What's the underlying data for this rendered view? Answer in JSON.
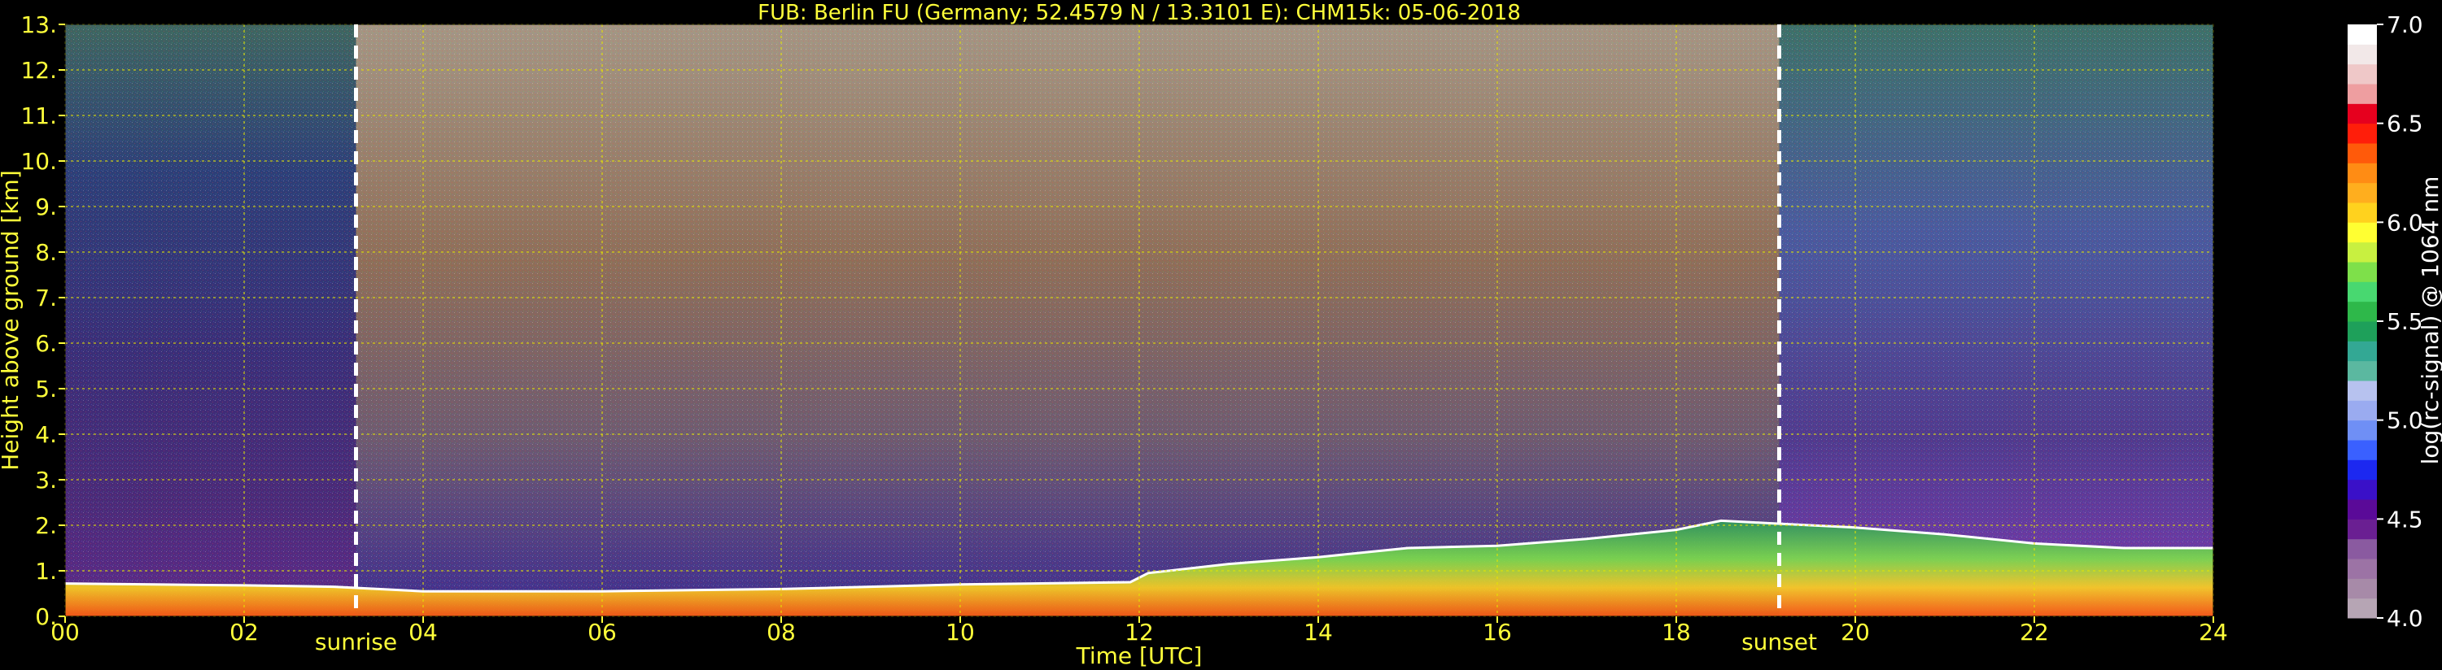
{
  "chart_data": {
    "type": "heatmap",
    "title": "FUB: Berlin FU (Germany; 52.4579 N / 13.3101 E):    CHM15k: 05-06-2018",
    "xlabel": "Time [UTC]",
    "ylabel": "Height above ground [km]",
    "xlim": [
      0,
      24
    ],
    "ylim": [
      0,
      13
    ],
    "x_ticks": [
      0,
      2,
      4,
      6,
      8,
      10,
      12,
      14,
      16,
      18,
      20,
      22,
      24
    ],
    "x_tick_labels": [
      "00",
      "02",
      "04",
      "06",
      "08",
      "10",
      "12",
      "14",
      "16",
      "18",
      "20",
      "22",
      "24"
    ],
    "y_ticks": [
      0,
      1,
      2,
      3,
      4,
      5,
      6,
      7,
      8,
      9,
      10,
      11,
      12,
      13
    ],
    "y_tick_labels": [
      "0.",
      "1.",
      "2.",
      "3.",
      "4.",
      "5.",
      "6.",
      "7.",
      "8.",
      "9.",
      "10.",
      "11.",
      "12.",
      "13."
    ],
    "grid": true,
    "events": [
      {
        "name": "sunrise",
        "time": 3.25
      },
      {
        "name": "sunset",
        "time": 19.15
      }
    ],
    "colorbar": {
      "label": "log(rc-signal) @ 1064 nm",
      "range": [
        4.0,
        7.0
      ],
      "ticks": [
        4.0,
        4.5,
        5.0,
        5.5,
        6.0,
        6.5,
        7.0
      ],
      "tick_labels": [
        "4.0",
        "4.5",
        "5.0",
        "5.5",
        "6.0",
        "6.5",
        "7.0"
      ],
      "colors": [
        "#b6a5b4",
        "#a78aa8",
        "#9c73a5",
        "#8a5aa0",
        "#6a1f92",
        "#5a0a98",
        "#3a10c8",
        "#1c28f0",
        "#3a60ff",
        "#6f8ff5",
        "#9aabf0",
        "#b7c2ef",
        "#5bb8a0",
        "#33a894",
        "#1ea05a",
        "#2eb84a",
        "#48d870",
        "#7ee04a",
        "#c8f040",
        "#ffff32",
        "#ffd21e",
        "#ffae1e",
        "#ff8c14",
        "#ff5a0a",
        "#ff1e0a",
        "#e6001e",
        "#ee9ea0",
        "#efc8c8",
        "#f2e8e8",
        "#ffffff"
      ]
    },
    "aerosol_layer_top_km": [
      [
        0,
        0.72
      ],
      [
        1,
        0.7
      ],
      [
        2,
        0.68
      ],
      [
        3,
        0.65
      ],
      [
        3.5,
        0.6
      ],
      [
        4,
        0.55
      ],
      [
        6,
        0.55
      ],
      [
        8,
        0.6
      ],
      [
        10,
        0.7
      ],
      [
        11.9,
        0.75
      ],
      [
        12.1,
        0.95
      ],
      [
        13,
        1.15
      ],
      [
        14,
        1.3
      ],
      [
        15,
        1.5
      ],
      [
        16,
        1.55
      ],
      [
        17,
        1.7
      ],
      [
        18,
        1.9
      ],
      [
        18.5,
        2.1
      ],
      [
        19,
        2.05
      ],
      [
        20,
        1.95
      ],
      [
        21,
        1.8
      ],
      [
        22,
        1.6
      ],
      [
        23,
        1.5
      ],
      [
        24,
        1.5
      ]
    ]
  }
}
